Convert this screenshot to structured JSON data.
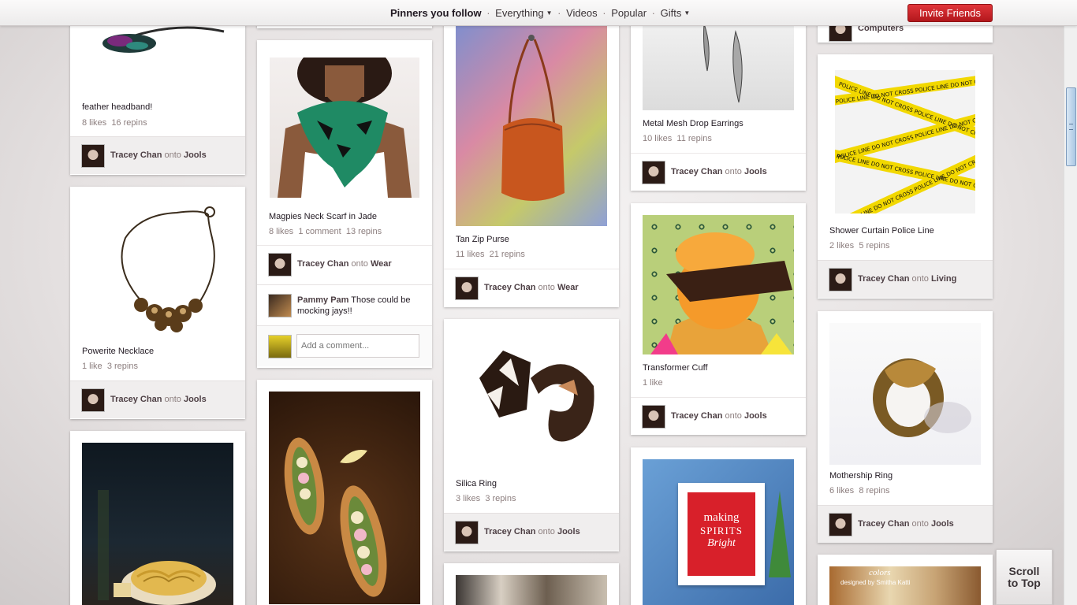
{
  "nav": {
    "pinners_you_follow": "Pinners you follow",
    "separator": "·",
    "everything": "Everything",
    "videos": "Videos",
    "popular": "Popular",
    "gifts": "Gifts",
    "caret_icon": "triangle-down",
    "invite_friends": "Invite Friends"
  },
  "scroll_top": {
    "line1": "Scroll",
    "line2": "to Top"
  },
  "colors": {
    "accent_red": "#c8232c",
    "attribution_bg": "#f0eeee",
    "muted_text": "#8c7e7e"
  },
  "pins": {
    "feather_headband": {
      "desc": "feather headband!",
      "likes": "8 likes",
      "repins": "16 repins",
      "user": "Tracey Chan",
      "onto": "onto",
      "board": "Jools"
    },
    "powerite": {
      "desc": "Powerite Necklace",
      "likes": "1 like",
      "repins": "3 repins",
      "user": "Tracey Chan",
      "onto": "onto",
      "board": "Jools"
    },
    "magpies_scarf": {
      "desc": "Magpies Neck Scarf in Jade",
      "likes": "8 likes",
      "comments": "1 comment",
      "repins": "13 repins",
      "user": "Tracey Chan",
      "onto": "onto",
      "board": "Wear",
      "comment_user": "Pammy Pam",
      "comment_text": "Those could be mocking jays!!",
      "add_comment_placeholder": "Add a comment..."
    },
    "tan_zip_purse": {
      "desc": "Tan Zip Purse",
      "likes": "11 likes",
      "repins": "21 repins",
      "user": "Tracey Chan",
      "onto": "onto",
      "board": "Wear"
    },
    "silica_ring": {
      "desc": "Silica Ring",
      "likes": "3 likes",
      "repins": "3 repins",
      "user": "Tracey Chan",
      "onto": "onto",
      "board": "Jools"
    },
    "metal_mesh": {
      "desc": "Metal Mesh Drop Earrings",
      "likes": "10 likes",
      "repins": "11 repins",
      "user": "Tracey Chan",
      "onto": "onto",
      "board": "Jools"
    },
    "transformer_cuff": {
      "desc": "Transformer Cuff",
      "likes": "1 like",
      "user": "Tracey Chan",
      "onto": "onto",
      "board": "Jools"
    },
    "computers_board": {
      "board": "Computers"
    },
    "shower_curtain": {
      "desc": "Shower Curtain Police Line",
      "likes": "2 likes",
      "repins": "5 repins",
      "user": "Tracey Chan",
      "onto": "onto",
      "board": "Living"
    },
    "mothership_ring": {
      "desc": "Mothership Ring",
      "likes": "6 likes",
      "repins": "8 repins",
      "user": "Tracey Chan",
      "onto": "onto",
      "board": "Jools"
    },
    "making_spirits": {
      "image_text_1": "making",
      "image_text_2": "SPIRITS",
      "image_text_3": "Bright"
    },
    "paint_colors": {
      "image_text_1": "colors",
      "image_text_2": "designed by Smitha Katti"
    },
    "police_tape_text": "POLICE LINE DO NOT CROSS"
  }
}
